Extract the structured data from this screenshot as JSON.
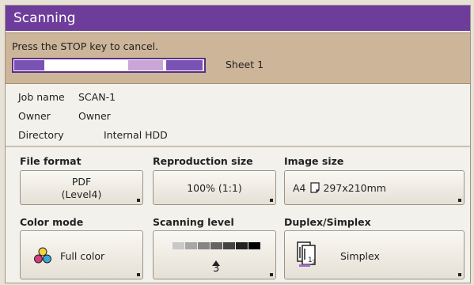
{
  "title": "Scanning",
  "status": {
    "message": "Press the STOP key to cancel.",
    "sheet_label": "Sheet 1",
    "progress_colors": [
      "#7a52b3",
      "#ffffff",
      "#c9a5d8",
      "#ffffff",
      "#7a52b3"
    ]
  },
  "info": {
    "job_name_label": "Job name",
    "job_name_value": "SCAN-1",
    "owner_label": "Owner",
    "owner_value": "Owner",
    "directory_label": "Directory",
    "directory_value": "Internal HDD"
  },
  "settings": {
    "file_format": {
      "label": "File format",
      "line1": "PDF",
      "line2": "(Level4)"
    },
    "reproduction_size": {
      "label": "Reproduction size",
      "value": "100% (1:1)"
    },
    "image_size": {
      "label": "Image size",
      "paper": "A4",
      "dimensions": "297x210mm"
    },
    "color_mode": {
      "label": "Color mode",
      "value": "Full color"
    },
    "scanning_level": {
      "label": "Scanning level",
      "value": "3",
      "level_count": 7,
      "current_level": 3
    },
    "duplex_simplex": {
      "label": "Duplex/Simplex",
      "value": "Simplex"
    }
  },
  "colors": {
    "title_bar": "#6e3d9b",
    "status_band": "#cdb59a",
    "accent": "#7a52b3"
  }
}
